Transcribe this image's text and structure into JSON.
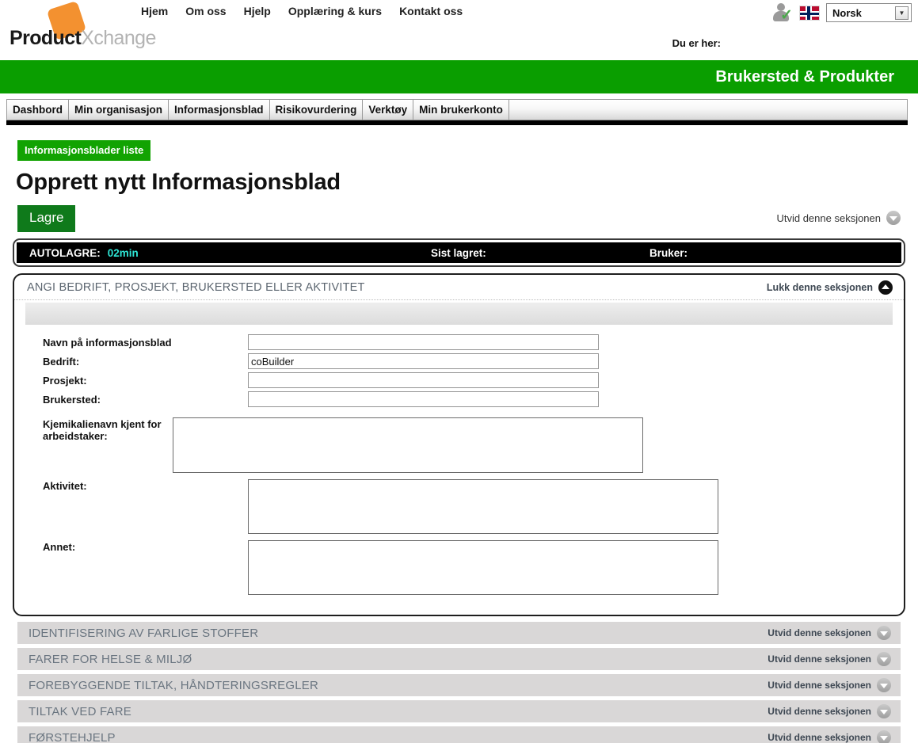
{
  "header": {
    "logo": {
      "part1": "Product",
      "part2": "Xchange"
    },
    "nav": [
      {
        "label": "Hjem"
      },
      {
        "label": "Om oss"
      },
      {
        "label": "Hjelp"
      },
      {
        "label": "Opplæring & kurs"
      },
      {
        "label": "Kontakt oss"
      }
    ],
    "language": {
      "value": "Norsk"
    },
    "breadcrumb_label": "Du er her:"
  },
  "banner": {
    "title": "Brukersted & Produkter",
    "color": "#0a9e00"
  },
  "tabs": [
    {
      "label": "Dashbord"
    },
    {
      "label": "Min organisasjon"
    },
    {
      "label": "Informasjonsblad"
    },
    {
      "label": "Risikovurdering"
    },
    {
      "label": "Verktøy"
    },
    {
      "label": "Min brukerkonto"
    }
  ],
  "crumb_badge": "Informasjonsblader liste",
  "page_title": "Opprett nytt Informasjonsblad",
  "toolbar": {
    "save_label": "Lagre",
    "expand_label": "Utvid denne seksjonen"
  },
  "autosave": {
    "label": "AUTOLAGRE:",
    "time": "02min",
    "time_color": "#2ee6d6",
    "last_saved_label": "Sist lagret:",
    "last_saved_value": "",
    "user_label": "Bruker:",
    "user_value": ""
  },
  "open_section": {
    "title": "ANGI BEDRIFT, PROSJEKT, BRUKERSTED ELLER AKTIVITET",
    "close_label": "Lukk denne seksjonen",
    "fields": [
      {
        "label": "Navn på informasjonsblad",
        "value": "",
        "type": "input"
      },
      {
        "label": "Bedrift:",
        "value": "coBuilder",
        "type": "input"
      },
      {
        "label": "Prosjekt:",
        "value": "",
        "type": "input"
      },
      {
        "label": "Brukersted:",
        "value": "",
        "type": "input"
      }
    ],
    "textareas": [
      {
        "label": "Kjemikalienavn kjent for arbeidstaker:",
        "value": ""
      },
      {
        "label": "Aktivitet:",
        "value": ""
      },
      {
        "label": "Annet:",
        "value": ""
      }
    ]
  },
  "closed_sections": [
    {
      "title": "IDENTIFISERING AV FARLIGE STOFFER",
      "expand_label": "Utvid denne seksjonen"
    },
    {
      "title": "FARER FOR HELSE & MILJØ",
      "expand_label": "Utvid denne seksjonen"
    },
    {
      "title": "FOREBYGGENDE TILTAK, HÅNDTERINGSREGLER",
      "expand_label": "Utvid denne seksjonen"
    },
    {
      "title": "TILTAK VED FARE",
      "expand_label": "Utvid denne seksjonen"
    },
    {
      "title": "FØRSTEHJELP",
      "expand_label": "Utvid denne seksjonen"
    }
  ]
}
